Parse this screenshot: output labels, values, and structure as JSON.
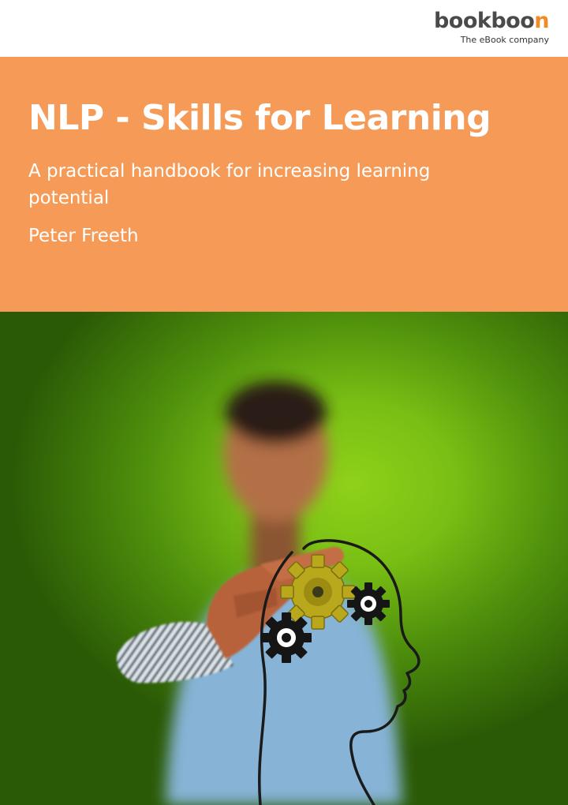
{
  "header": {
    "logo": {
      "word_main": "bookboo",
      "word_accent": "n",
      "tagline": "The eBook company",
      "accent_color": "#f08a24"
    }
  },
  "cover": {
    "title": "NLP - Skills for Learning",
    "subtitle": "A practical handbook for increasing learning potential",
    "author": "Peter Freeth",
    "banner_color": "#f59b57"
  },
  "image": {
    "icon": "head-with-gears-illustration"
  }
}
